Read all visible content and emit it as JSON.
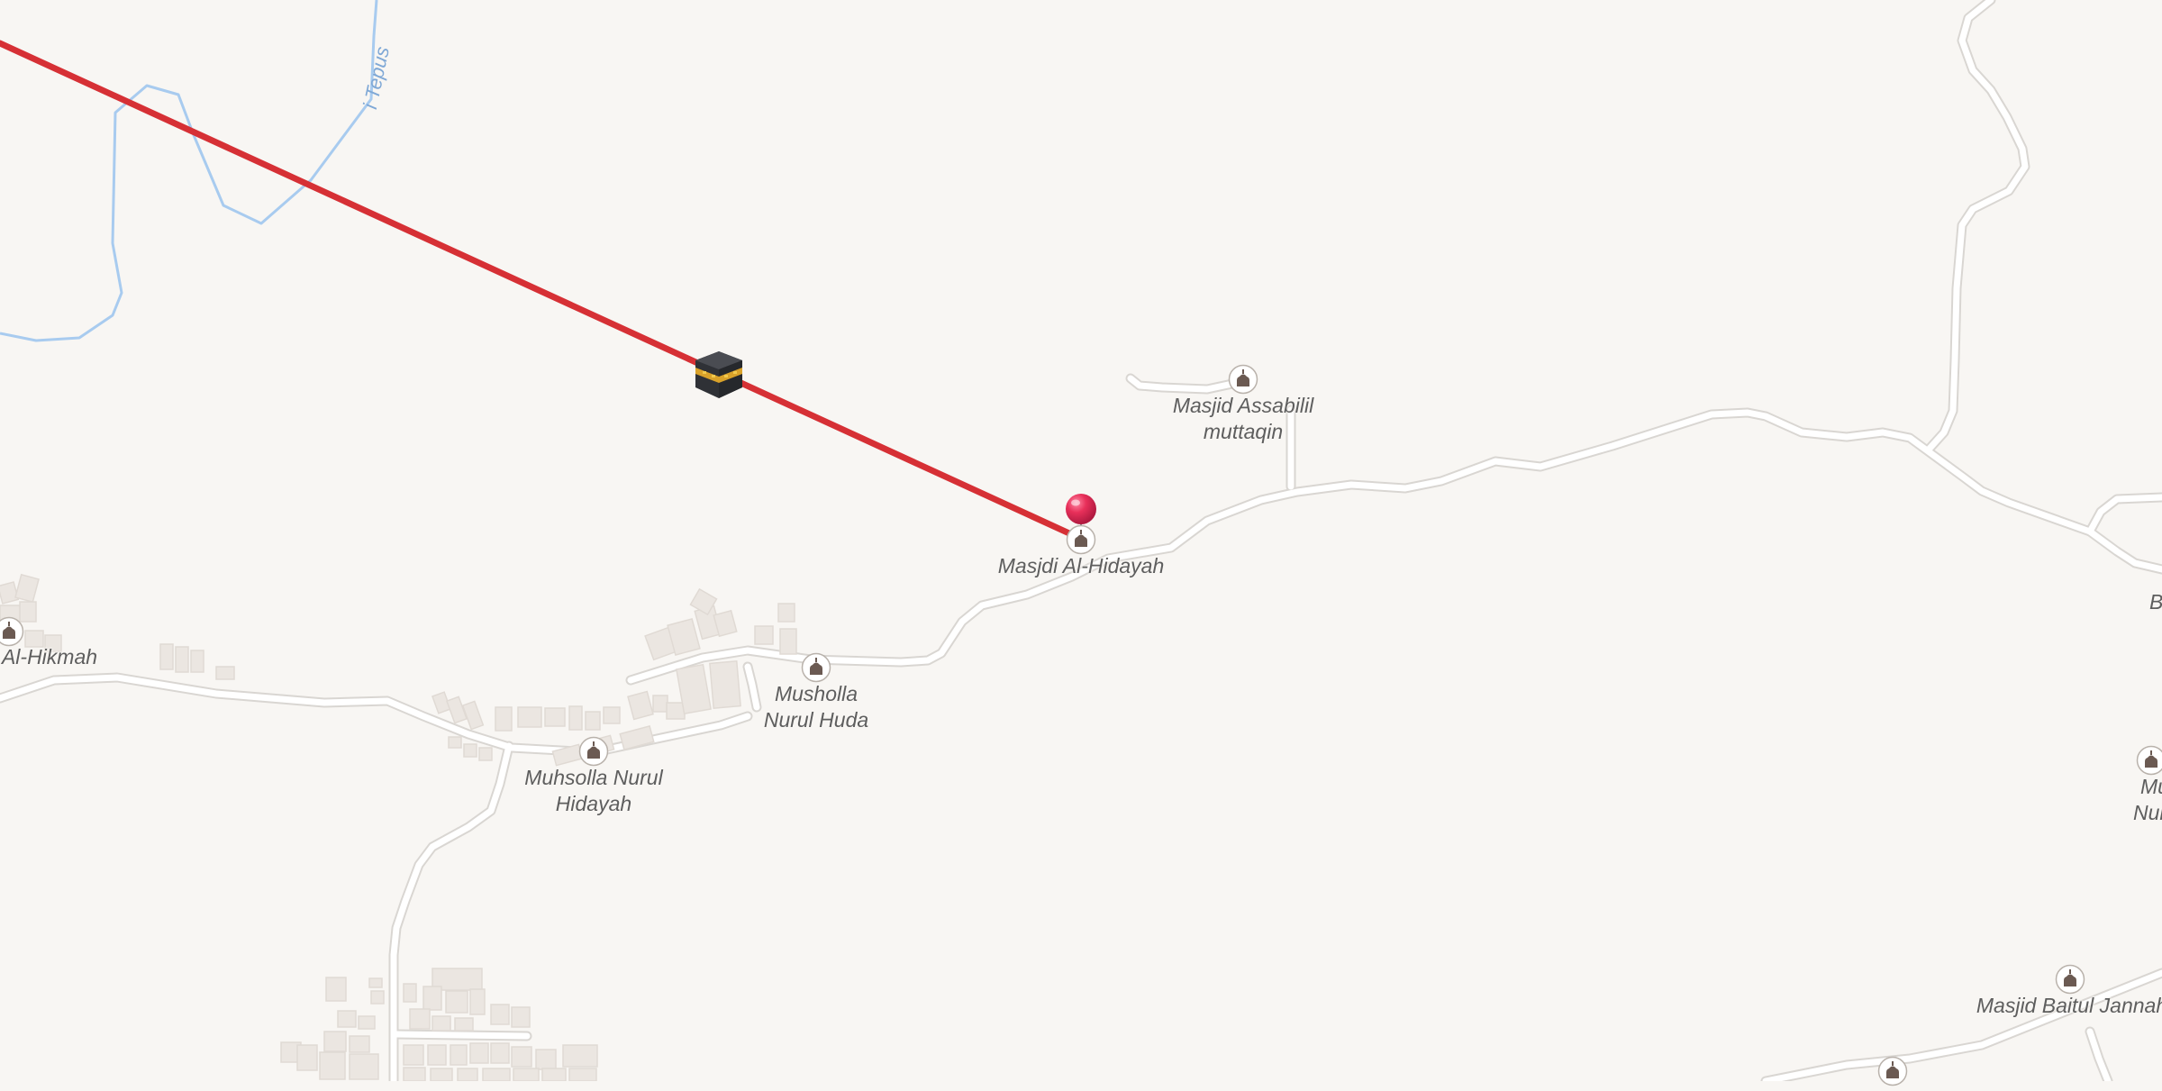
{
  "map": {
    "background_color": "#f8f6f3",
    "road_color": "#ffffff",
    "road_casing_color": "#d9d6d2",
    "building_color": "#ebe6e1",
    "water_color": "#a8cbef",
    "qibla_line_color": "#d63035"
  },
  "water": {
    "stream_label": "i Tepus"
  },
  "qibla": {
    "kaaba_icon": "kaaba-icon",
    "origin_pin_icon": "map-pin-icon",
    "pin_color": "#e8305a"
  },
  "pois": [
    {
      "id": "masjid-assabilil",
      "icon": "mosque-icon",
      "lines": [
        "Masjid Assabilil",
        "muttaqin"
      ]
    },
    {
      "id": "masjdi-al-hidayah",
      "icon": "mosque-icon",
      "lines": [
        "Masjdi Al-Hidayah"
      ]
    },
    {
      "id": "al-hikmah",
      "icon": "mosque-icon",
      "lines": [
        "Al-Hikmah"
      ]
    },
    {
      "id": "musholla-nurul-huda",
      "icon": "mosque-icon",
      "lines": [
        "Musholla",
        "Nurul Huda"
      ]
    },
    {
      "id": "muhsolla-nurul-hidayah",
      "icon": "mosque-icon",
      "lines": [
        "Muhsolla Nurul",
        "Hidayah"
      ]
    },
    {
      "id": "muhs-right",
      "icon": "mosque-icon",
      "lines": [
        "Muhs",
        "Nurul"
      ]
    },
    {
      "id": "masjid-baitul-jannah",
      "icon": "mosque-icon",
      "lines": [
        "Masjid Baitul Jannah"
      ]
    }
  ],
  "edge_labels": {
    "right_b": "B"
  }
}
